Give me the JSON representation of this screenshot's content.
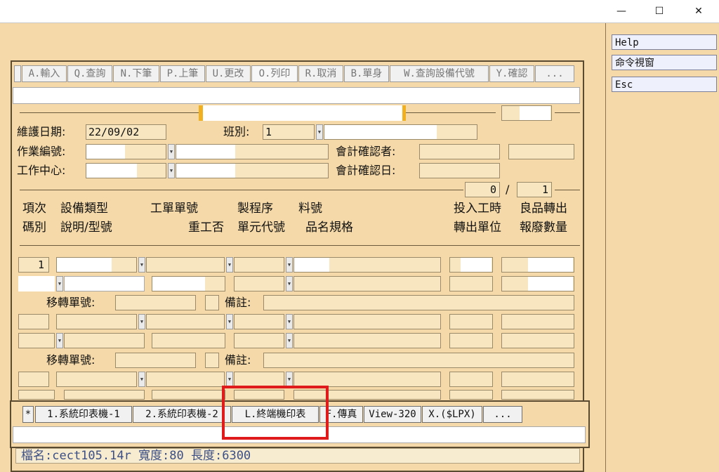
{
  "window": {
    "minimize_glyph": "—",
    "maximize_glyph": "☐",
    "close_glyph": "✕"
  },
  "side_menu": {
    "help": "Help",
    "cmd_window": "命令視窗",
    "esc": "Esc"
  },
  "toolbar": {
    "input": "A.輸入",
    "query": "Q.查詢",
    "next": "N.下筆",
    "prev": "P.上筆",
    "update": "U.更改",
    "print": "O.列印",
    "cancel": "R.取消",
    "body": "B.單身",
    "equip_query": "W.查詢設備代號",
    "confirm": "Y.確認",
    "more": "..."
  },
  "header": {
    "maint_date_label": "維護日期:",
    "maint_date": "22/09/02",
    "shift_label": "班別:",
    "shift": "1",
    "job_no_label": "作業編號:",
    "work_center_label": "工作中心:",
    "acct_confirmer_label": "會計確認者:",
    "acct_confirm_date_label": "會計確認日:"
  },
  "pager": {
    "current": "0",
    "sep": "/",
    "total": "1"
  },
  "columns": {
    "item": "項次",
    "equip_type": "設備類型",
    "work_order": "工單單號",
    "process": "製程序",
    "part_no": "料號",
    "input_hours": "投入工時",
    "good_transfer": "良品轉出",
    "code": "碼別",
    "desc_model": "說明/型號",
    "rework": "重工否",
    "unit_code": "單元代號",
    "spec": "品名規格",
    "transfer_unit": "轉出單位",
    "scrap_qty": "報廢數量"
  },
  "rows": {
    "first_item": "1",
    "transfer_no_label": "移轉單號:",
    "remark_label": "備註:"
  },
  "print_bar": {
    "star": "*",
    "sys_printer_1": "1.系統印表機-1",
    "sys_printer_2": "2.系統印表機-2",
    "terminal_printer": "L.終端機印表",
    "fax": "F.傳真",
    "view": "View-320",
    "lpx": "X.($LPX)",
    "more": "..."
  },
  "status": {
    "text": "檔名:cect105.14r 寬度:80 長度:6300"
  },
  "highlight_color": "#e01b1b"
}
